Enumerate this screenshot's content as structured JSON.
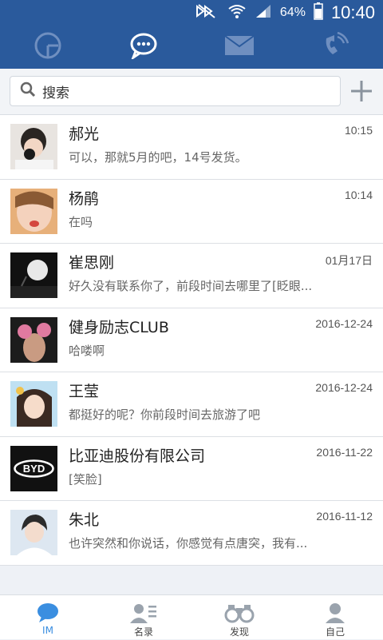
{
  "status_bar": {
    "battery_percent": "64%",
    "clock": "10:40"
  },
  "top_tabs": [
    {
      "icon": "g-logo-icon",
      "active": false
    },
    {
      "icon": "chat-bubbles-icon",
      "active": true
    },
    {
      "icon": "mail-icon",
      "active": false
    },
    {
      "icon": "phone-icon",
      "active": false
    }
  ],
  "search": {
    "label": "搜索"
  },
  "conversations": [
    {
      "name": "郝光",
      "time": "10:15",
      "preview": "可以，那就5月的吧，14号发货。"
    },
    {
      "name": "杨鹃",
      "time": "10:14",
      "preview": "在吗"
    },
    {
      "name": "崔思刚",
      "time": "01月17日",
      "preview": "好久没有联系你了，前段时间去哪里了[眨眼..."
    },
    {
      "name": "健身励志CLUB",
      "time": "2016-12-24",
      "preview": "哈喽啊"
    },
    {
      "name": "王莹",
      "time": "2016-12-24",
      "preview": "都挺好的呢？你前段时间去旅游了吧"
    },
    {
      "name": "比亚迪股份有限公司",
      "time": "2016-11-22",
      "preview": "[笑脸]",
      "avatar_text": "BYD"
    },
    {
      "name": "朱北",
      "time": "2016-11-12",
      "preview": "也许突然和你说话，你感觉有点唐突，我有..."
    }
  ],
  "bottom_nav": [
    {
      "label": "IM",
      "icon": "chat-icon",
      "active": true
    },
    {
      "label": "名录",
      "icon": "contacts-list-icon",
      "active": false
    },
    {
      "label": "发现",
      "icon": "binoculars-icon",
      "active": false
    },
    {
      "label": "自己",
      "icon": "person-icon",
      "active": false
    }
  ],
  "colors": {
    "header_blue": "#2a5a9c",
    "active_blue": "#3a8ee0",
    "background": "#eef1f6"
  }
}
